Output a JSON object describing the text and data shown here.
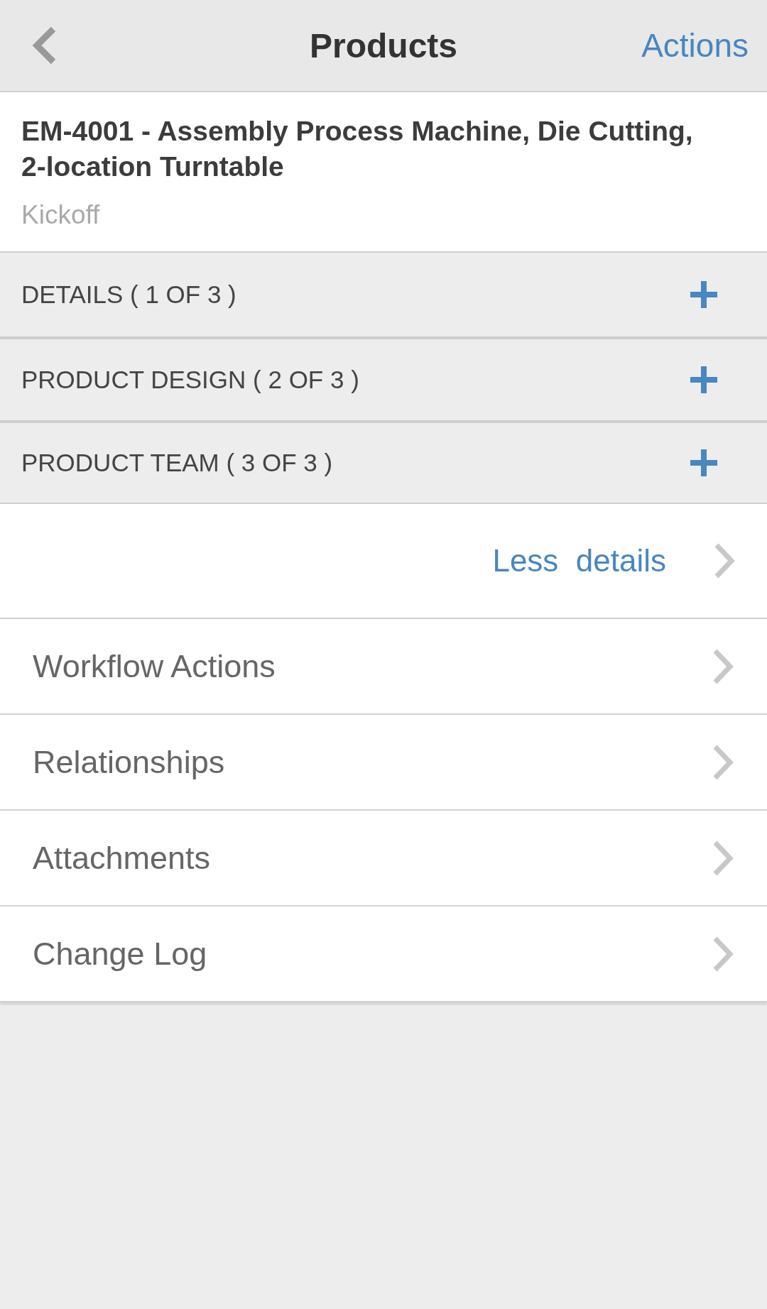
{
  "header": {
    "title": "Products",
    "action": "Actions"
  },
  "product": {
    "title": "EM-4001 - Assembly Process Machine, Die Cutting, 2-location Turntable",
    "status": "Kickoff"
  },
  "sections": [
    {
      "label": "DETAILS ( 1 OF 3 )",
      "expanded": false
    },
    {
      "label": "PRODUCT DESIGN ( 2 OF 3 )",
      "expanded": false
    },
    {
      "label": "PRODUCT TEAM ( 3 OF 3 )",
      "expanded": false
    }
  ],
  "details_toggle": {
    "label": "Less  details"
  },
  "menu": [
    {
      "label": "Workflow Actions"
    },
    {
      "label": "Relationships"
    },
    {
      "label": "Attachments"
    },
    {
      "label": "Change Log"
    }
  ]
}
